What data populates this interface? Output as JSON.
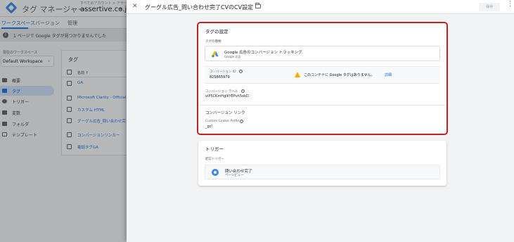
{
  "app": {
    "title": "タグ マネージャー",
    "account_breadcrumb": "すべてのアカウント > アサーティ",
    "container_name": "assertive.co.jp"
  },
  "tabs": [
    {
      "label": "ワークスペース",
      "active": true
    },
    {
      "label": "バージョン",
      "active": false
    },
    {
      "label": "管理",
      "active": false
    }
  ],
  "banner": {
    "text": "1 ページで Google タグが見つかりませんでした"
  },
  "workspace": {
    "label": "現在のワークスペース",
    "name": "Default Workspace"
  },
  "nav": [
    {
      "label": "概要",
      "icon": "overview-icon",
      "active": false
    },
    {
      "label": "タグ",
      "icon": "tag-icon",
      "active": true
    },
    {
      "label": "トリガー",
      "icon": "trigger-icon",
      "active": false
    },
    {
      "label": "変数",
      "icon": "variable-icon",
      "active": false
    },
    {
      "label": "フォルダ",
      "icon": "folder-icon",
      "active": false
    },
    {
      "label": "テンプレート",
      "icon": "template-icon",
      "active": false
    }
  ],
  "tag_list": {
    "title": "タグ",
    "column_name": "名前 ↑",
    "rows": [
      "GA",
      "Microsoft Clarity - Official",
      "カスタム HTML",
      "グーグル広告_問い合わせ完",
      "コンバージョンリンカー",
      "電話タグGA"
    ]
  },
  "panel": {
    "title": "グーグル広告_問い合わせ完了CVのCV設定",
    "save_label": "保存"
  },
  "tag_config": {
    "title": "タグの設定",
    "type_label": "タグの種類",
    "type_name": "Google 広告のコンバージョン トラッキング",
    "type_sub": "Google 広告",
    "conversion_id_label": "コンバージョン ID",
    "conversion_id_value": "825865979",
    "warning_text": "このコンテナに Google タグはありません。",
    "warning_link": "詳細",
    "conversion_label_label": "コンバージョン ラベル",
    "conversion_label_value": "viP5CKmHgIkYEPvh5okD",
    "linker_title": "コンバージョン リンク",
    "cookie_prefix_label": "Custom Cookie Prefix",
    "cookie_prefix_value": "_gcl"
  },
  "triggering": {
    "title": "トリガー",
    "firing_label": "配信トリガー",
    "trigger_name": "問い合わせ完了",
    "trigger_type": "ページビュー"
  },
  "colors": {
    "accent": "#1a73e8",
    "highlight_border": "#c5221f",
    "warning": "#f9ab00"
  }
}
